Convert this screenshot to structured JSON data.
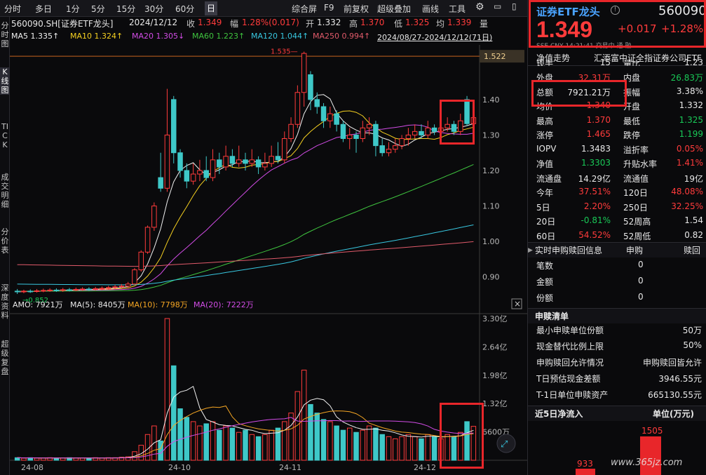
{
  "toolbar": {
    "left": [
      "分时",
      "多日",
      "1分",
      "5分",
      "15分",
      "30分",
      "60分",
      "日"
    ],
    "selected": "日",
    "right": [
      "综合屏",
      "F9",
      "前复权",
      "超级叠加",
      "画线",
      "工具"
    ]
  },
  "side_tabs": [
    "分时图",
    "K线图",
    "TICK",
    "成交明细",
    "分价表",
    "深度资料",
    "超级复盘"
  ],
  "quote": {
    "code_name": "560090.SH[证券ETF龙头]",
    "date": "2024/12/12",
    "close_label": "收",
    "close": "1.349",
    "amp_label": "幅",
    "amp": "1.28%(0.017)",
    "open_label": "开",
    "open": "1.332",
    "high_label": "高",
    "high": "1.370",
    "low_label": "低",
    "low": "1.325",
    "avg_label": "均",
    "avg": "1.339",
    "vol_label": "量"
  },
  "ma": {
    "ma5": "MA5 1.335↑",
    "ma10": "MA10 1.324↑",
    "ma20": "MA20 1.305↓",
    "ma60": "MA60 1.223↑",
    "ma120": "MA120 1.044↑",
    "ma250": "MA250 0.994↑",
    "range": "2024/08/27-2024/12/12(71日)"
  },
  "price_axis": [
    "1.40",
    "1.30",
    "1.20",
    "1.10",
    "1.00",
    "0.90"
  ],
  "price_tag": "1.522",
  "high_mark": "1.535",
  "low_mark": "0.852",
  "volume_info": {
    "amo": "AMO: 7921万",
    "ma5": "MA(5): 8405万",
    "ma10": "MA(10): 7798万",
    "ma20": "MA(20): 7222万"
  },
  "volume_axis": [
    "3.30亿",
    "2.64亿",
    "1.98亿",
    "1.32亿",
    "6600万"
  ],
  "date_axis": [
    "24-08",
    "24-10",
    "24-11",
    "24-12"
  ],
  "chart_data": {
    "type": "candlestick",
    "ylim": [
      0.85,
      1.55
    ],
    "candles": [
      [
        0.86,
        0.858,
        0.866,
        0.852
      ],
      [
        0.858,
        0.86,
        0.864,
        0.854
      ],
      [
        0.86,
        0.859,
        0.865,
        0.855
      ],
      [
        0.859,
        0.861,
        0.866,
        0.856
      ],
      [
        0.861,
        0.862,
        0.867,
        0.857
      ],
      [
        0.862,
        0.863,
        0.868,
        0.858
      ],
      [
        0.863,
        0.862,
        0.868,
        0.858
      ],
      [
        0.862,
        0.864,
        0.869,
        0.858
      ],
      [
        0.864,
        0.863,
        0.869,
        0.859
      ],
      [
        0.863,
        0.865,
        0.87,
        0.86
      ],
      [
        0.865,
        0.866,
        0.871,
        0.861
      ],
      [
        0.866,
        0.865,
        0.871,
        0.861
      ],
      [
        0.865,
        0.867,
        0.872,
        0.862
      ],
      [
        0.867,
        0.868,
        0.873,
        0.863
      ],
      [
        0.868,
        0.87,
        0.875,
        0.864
      ],
      [
        0.87,
        0.872,
        0.878,
        0.866
      ],
      [
        0.872,
        0.874,
        0.88,
        0.868
      ],
      [
        0.874,
        0.88,
        0.886,
        0.87
      ],
      [
        0.88,
        0.92,
        0.925,
        0.878
      ],
      [
        0.92,
        0.97,
        0.975,
        0.915
      ],
      [
        0.97,
        1.04,
        1.045,
        0.965
      ],
      [
        1.04,
        1.1,
        1.11,
        1.03
      ],
      [
        1.18,
        1.15,
        1.25,
        1.14
      ],
      [
        1.15,
        1.3,
        1.43,
        1.14
      ],
      [
        1.4,
        1.25,
        1.41,
        1.22
      ],
      [
        1.25,
        1.2,
        1.26,
        1.18
      ],
      [
        1.2,
        1.17,
        1.22,
        1.15
      ],
      [
        1.17,
        1.19,
        1.22,
        1.16
      ],
      [
        1.19,
        1.2,
        1.23,
        1.17
      ],
      [
        1.2,
        1.18,
        1.24,
        1.17
      ],
      [
        1.18,
        1.23,
        1.26,
        1.17
      ],
      [
        1.23,
        1.21,
        1.25,
        1.19
      ],
      [
        1.21,
        1.24,
        1.27,
        1.2
      ],
      [
        1.24,
        1.22,
        1.26,
        1.21
      ],
      [
        1.22,
        1.23,
        1.27,
        1.21
      ],
      [
        1.23,
        1.22,
        1.25,
        1.2
      ],
      [
        1.22,
        1.23,
        1.26,
        1.21
      ],
      [
        1.23,
        1.21,
        1.24,
        1.19
      ],
      [
        1.21,
        1.22,
        1.25,
        1.2
      ],
      [
        1.22,
        1.24,
        1.27,
        1.21
      ],
      [
        1.24,
        1.23,
        1.28,
        1.22
      ],
      [
        1.23,
        1.29,
        1.31,
        1.22
      ],
      [
        1.29,
        1.33,
        1.35,
        1.28
      ],
      [
        1.33,
        1.42,
        1.44,
        1.32
      ],
      [
        1.42,
        1.53,
        1.535,
        1.38
      ],
      [
        1.47,
        1.4,
        1.48,
        1.37
      ],
      [
        1.4,
        1.38,
        1.42,
        1.36
      ],
      [
        1.38,
        1.34,
        1.39,
        1.32
      ],
      [
        1.34,
        1.36,
        1.38,
        1.32
      ],
      [
        1.36,
        1.33,
        1.37,
        1.31
      ],
      [
        1.33,
        1.29,
        1.34,
        1.28
      ],
      [
        1.29,
        1.3,
        1.32,
        1.26
      ],
      [
        1.3,
        1.29,
        1.31,
        1.25
      ],
      [
        1.29,
        1.32,
        1.34,
        1.28
      ],
      [
        1.32,
        1.33,
        1.35,
        1.3
      ],
      [
        1.33,
        1.27,
        1.34,
        1.24
      ],
      [
        1.27,
        1.25,
        1.29,
        1.24
      ],
      [
        1.25,
        1.26,
        1.28,
        1.24
      ],
      [
        1.26,
        1.27,
        1.29,
        1.25
      ],
      [
        1.27,
        1.29,
        1.3,
        1.26
      ],
      [
        1.29,
        1.3,
        1.32,
        1.27
      ],
      [
        1.3,
        1.31,
        1.33,
        1.29
      ],
      [
        1.31,
        1.3,
        1.33,
        1.29
      ],
      [
        1.3,
        1.32,
        1.34,
        1.29
      ],
      [
        1.32,
        1.31,
        1.33,
        1.3
      ],
      [
        1.31,
        1.32,
        1.34,
        1.3
      ],
      [
        1.32,
        1.33,
        1.35,
        1.31
      ],
      [
        1.33,
        1.31,
        1.34,
        1.3
      ],
      [
        1.31,
        1.34,
        1.36,
        1.3
      ],
      [
        1.4,
        1.332,
        1.41,
        1.325
      ],
      [
        1.332,
        1.349,
        1.37,
        1.325
      ]
    ],
    "volume": [
      0.06,
      0.05,
      0.06,
      0.05,
      0.05,
      0.06,
      0.05,
      0.05,
      0.06,
      0.05,
      0.05,
      0.05,
      0.06,
      0.05,
      0.06,
      0.06,
      0.07,
      0.08,
      0.2,
      0.35,
      0.6,
      0.8,
      0.45,
      3.3,
      2.2,
      1.2,
      1.0,
      0.9,
      0.8,
      0.85,
      0.9,
      0.7,
      0.8,
      0.75,
      0.65,
      0.7,
      0.6,
      0.55,
      0.6,
      0.7,
      0.75,
      0.9,
      1.1,
      1.6,
      2.1,
      1.3,
      1.1,
      0.95,
      0.9,
      0.8,
      0.7,
      0.75,
      0.65,
      0.7,
      0.8,
      0.75,
      0.6,
      0.55,
      0.5,
      0.55,
      0.6,
      0.55,
      0.5,
      0.6,
      0.55,
      0.5,
      0.6,
      0.55,
      0.65,
      0.9,
      0.79
    ],
    "ma_lines": {
      "MA5": {
        "color": "#f0f0f0"
      },
      "MA10": {
        "color": "#f5d020"
      },
      "MA20": {
        "color": "#d24ce6"
      },
      "MA60": {
        "color": "#3fc43f"
      },
      "MA120": {
        "color": "#38c7e0"
      },
      "MA250": {
        "color": "#e05a6a"
      }
    }
  },
  "panel": {
    "name": "证券ETF龙头",
    "code": "560090",
    "price": "1.349",
    "change": "+0.017",
    "change_pct": "+1.28%",
    "sub": [
      "SSE",
      "CNY",
      "14:21:41",
      "交易中",
      "通",
      "融"
    ],
    "tabs": [
      "净值走势",
      "汇添富中证全指证券公司ETF"
    ],
    "rows": [
      {
        "l1": "现手",
        "v1": "15",
        "l2": "量比",
        "v2": "1.23",
        "c1": "white",
        "c2": "white"
      },
      {
        "l1": "外盘",
        "v1": "32.31万",
        "l2": "内盘",
        "v2": "26.83万",
        "c1": "red",
        "c2": "green"
      },
      {
        "l1": "总额",
        "v1": "7921.21万",
        "l2": "振幅",
        "v2": "3.38%",
        "c1": "white",
        "c2": "white"
      },
      {
        "l1": "均价",
        "v1": "1.340",
        "l2": "开盘",
        "v2": "1.332",
        "c1": "red",
        "c2": "white"
      },
      {
        "l1": "最高",
        "v1": "1.370",
        "l2": "最低",
        "v2": "1.325",
        "c1": "red",
        "c2": "green"
      },
      {
        "l1": "涨停",
        "v1": "1.465",
        "l2": "跌停",
        "v2": "1.199",
        "c1": "red",
        "c2": "green"
      },
      {
        "l1": "IOPV",
        "v1": "1.3483",
        "l2": "溢折率",
        "v2": "0.05%",
        "c1": "white",
        "c2": "red"
      },
      {
        "l1": "净值",
        "v1": "1.3303",
        "l2": "升贴水率",
        "v2": "1.41%",
        "c1": "green",
        "c2": "red"
      },
      {
        "l1": "流通盘",
        "v1": "14.29亿",
        "l2": "流通值",
        "v2": "19亿",
        "c1": "white",
        "c2": "white"
      },
      {
        "l1": "今年",
        "v1": "37.51%",
        "l2": "120日",
        "v2": "48.08%",
        "c1": "red",
        "c2": "red"
      },
      {
        "l1": "5日",
        "v1": "2.20%",
        "l2": "250日",
        "v2": "32.25%",
        "c1": "red",
        "c2": "red"
      },
      {
        "l1": "20日",
        "v1": "-0.81%",
        "l2": "52周高",
        "v2": "1.54",
        "c1": "green",
        "c2": "white"
      },
      {
        "l1": "60日",
        "v1": "54.52%",
        "l2": "52周低",
        "v2": "0.82",
        "c1": "red",
        "c2": "white"
      }
    ],
    "sg_title": "实时申购赎回信息",
    "sg_h1": "申购",
    "sg_h2": "赎回",
    "sg_rows": [
      {
        "l": "笔数",
        "v": "0"
      },
      {
        "l": "金额",
        "v": "0"
      },
      {
        "l": "份额",
        "v": "0"
      }
    ],
    "list_title": "申赎清单",
    "list_rows": [
      {
        "l": "最小申赎单位份额",
        "v": "50万"
      },
      {
        "l": "现金替代比例上限",
        "v": "50%"
      },
      {
        "l": "申购赎回允许情况",
        "v": "申购赎回皆允许"
      },
      {
        "l": "T日预估现金差额",
        "v": "3946.55元"
      },
      {
        "l": "T-1日单位申赎资产",
        "v": "665130.55元"
      }
    ],
    "flow_title": "近5日净流入",
    "flow_unit": "单位(万元)",
    "flow_values": [
      "933",
      "1505"
    ],
    "watermark": "www.365jz.com"
  }
}
